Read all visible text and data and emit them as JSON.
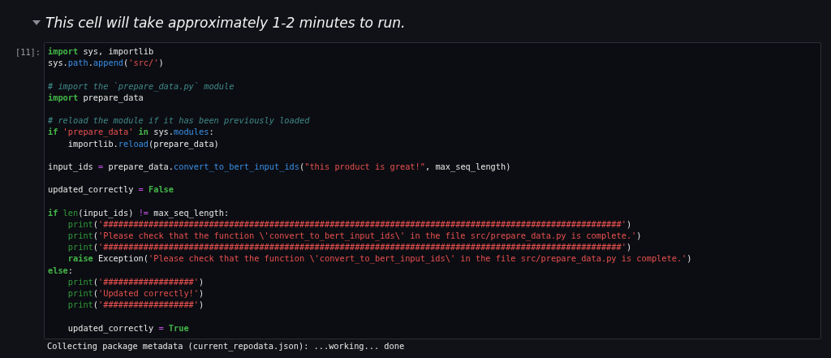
{
  "heading": {
    "text": "This cell will take approximately 1-2 minutes to run.",
    "expanded": true
  },
  "cell": {
    "prompt": "[11]:",
    "lines": [
      {
        "kind": "code",
        "tokens": [
          {
            "kind": "keyword",
            "text": "import"
          },
          {
            "kind": "plain",
            "text": " sys, importlib"
          }
        ]
      },
      {
        "kind": "code",
        "tokens": [
          {
            "kind": "plain",
            "text": "sys."
          },
          {
            "kind": "attr",
            "text": "path"
          },
          {
            "kind": "plain",
            "text": "."
          },
          {
            "kind": "attr",
            "text": "append"
          },
          {
            "kind": "plain",
            "text": "("
          },
          {
            "kind": "string",
            "text": "'src/'"
          },
          {
            "kind": "plain",
            "text": ")"
          }
        ]
      },
      {
        "kind": "blank"
      },
      {
        "kind": "code",
        "tokens": [
          {
            "kind": "comment",
            "text": "# import the `prepare_data.py` module"
          }
        ]
      },
      {
        "kind": "code",
        "tokens": [
          {
            "kind": "keyword",
            "text": "import"
          },
          {
            "kind": "plain",
            "text": " prepare_data"
          }
        ]
      },
      {
        "kind": "blank"
      },
      {
        "kind": "code",
        "tokens": [
          {
            "kind": "comment",
            "text": "# reload the module if it has been previously loaded"
          }
        ]
      },
      {
        "kind": "code",
        "tokens": [
          {
            "kind": "keyword",
            "text": "if "
          },
          {
            "kind": "string",
            "text": "'prepare_data' "
          },
          {
            "kind": "keyword",
            "text": "in"
          },
          {
            "kind": "plain",
            "text": " sys."
          },
          {
            "kind": "attr",
            "text": "modules"
          },
          {
            "kind": "plain",
            "text": ":"
          }
        ]
      },
      {
        "kind": "code",
        "tokens": [
          {
            "kind": "plain",
            "text": "    importlib."
          },
          {
            "kind": "attr",
            "text": "reload"
          },
          {
            "kind": "plain",
            "text": "(prepare_data)"
          }
        ]
      },
      {
        "kind": "blank"
      },
      {
        "kind": "code",
        "tokens": [
          {
            "kind": "plain",
            "text": "input_ids "
          },
          {
            "kind": "operator",
            "text": "="
          },
          {
            "kind": "plain",
            "text": " prepare_data."
          },
          {
            "kind": "attr",
            "text": "convert_to_bert_input_ids"
          },
          {
            "kind": "plain",
            "text": "("
          },
          {
            "kind": "string",
            "text": "\"this product is great!\""
          },
          {
            "kind": "plain",
            "text": ", max_seq_length)"
          }
        ]
      },
      {
        "kind": "blank"
      },
      {
        "kind": "code",
        "tokens": [
          {
            "kind": "plain",
            "text": "updated_correctly "
          },
          {
            "kind": "operator",
            "text": "= "
          },
          {
            "kind": "keyword",
            "text": "False"
          }
        ]
      },
      {
        "kind": "blank"
      },
      {
        "kind": "code",
        "tokens": [
          {
            "kind": "keyword",
            "text": "if "
          },
          {
            "kind": "builtin",
            "text": "len"
          },
          {
            "kind": "plain",
            "text": "(input_ids) "
          },
          {
            "kind": "operator",
            "text": "!="
          },
          {
            "kind": "plain",
            "text": " max_seq_length:"
          }
        ]
      },
      {
        "kind": "code",
        "tokens": [
          {
            "kind": "builtin",
            "text": "    print"
          },
          {
            "kind": "plain",
            "text": "("
          },
          {
            "kind": "string",
            "text": "'#######################################################################################################'"
          },
          {
            "kind": "plain",
            "text": ")"
          }
        ]
      },
      {
        "kind": "code",
        "tokens": [
          {
            "kind": "builtin",
            "text": "    print"
          },
          {
            "kind": "plain",
            "text": "("
          },
          {
            "kind": "string",
            "text": "'Please check that the function \\'convert_to_bert_input_ids\\' in the file src/prepare_data.py is complete.'"
          },
          {
            "kind": "plain",
            "text": ")"
          }
        ]
      },
      {
        "kind": "code",
        "tokens": [
          {
            "kind": "builtin",
            "text": "    print"
          },
          {
            "kind": "plain",
            "text": "("
          },
          {
            "kind": "string",
            "text": "'#######################################################################################################'"
          },
          {
            "kind": "plain",
            "text": ")"
          }
        ]
      },
      {
        "kind": "code",
        "tokens": [
          {
            "kind": "keyword",
            "text": "    raise"
          },
          {
            "kind": "plain",
            "text": " Exception("
          },
          {
            "kind": "string",
            "text": "'Please check that the function \\'convert_to_bert_input_ids\\' in the file src/prepare_data.py is complete.'"
          },
          {
            "kind": "plain",
            "text": ")"
          }
        ]
      },
      {
        "kind": "code",
        "tokens": [
          {
            "kind": "keyword",
            "text": "else"
          },
          {
            "kind": "plain",
            "text": ":"
          }
        ]
      },
      {
        "kind": "code",
        "tokens": [
          {
            "kind": "builtin",
            "text": "    print"
          },
          {
            "kind": "plain",
            "text": "("
          },
          {
            "kind": "string",
            "text": "'##################'"
          },
          {
            "kind": "plain",
            "text": ")"
          }
        ]
      },
      {
        "kind": "code",
        "tokens": [
          {
            "kind": "builtin",
            "text": "    print"
          },
          {
            "kind": "plain",
            "text": "("
          },
          {
            "kind": "string",
            "text": "'Updated correctly!'"
          },
          {
            "kind": "plain",
            "text": ")"
          }
        ]
      },
      {
        "kind": "code",
        "tokens": [
          {
            "kind": "builtin",
            "text": "    print"
          },
          {
            "kind": "plain",
            "text": "("
          },
          {
            "kind": "string",
            "text": "'##################'"
          },
          {
            "kind": "plain",
            "text": ")"
          }
        ]
      },
      {
        "kind": "blank"
      },
      {
        "kind": "code",
        "tokens": [
          {
            "kind": "plain",
            "text": "    updated_correctly "
          },
          {
            "kind": "operator",
            "text": "= "
          },
          {
            "kind": "keyword",
            "text": "True"
          }
        ]
      }
    ]
  },
  "output": "Collecting package metadata (current_repodata.json): ...working... done"
}
